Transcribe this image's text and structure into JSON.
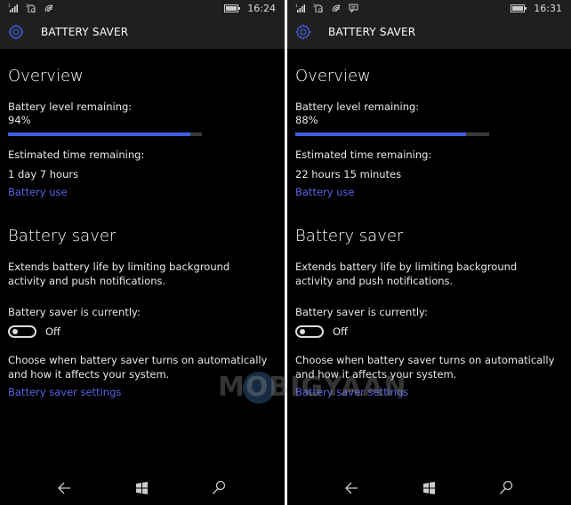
{
  "screens": [
    {
      "status": {
        "time": "16:24",
        "icons": [
          "signal-icon",
          "sim-icon",
          "wifi-icon"
        ]
      },
      "header": {
        "title": "BATTERY SAVER"
      },
      "overview": {
        "heading": "Overview",
        "battery_label": "Battery level remaining:",
        "battery_value": "94%",
        "battery_fraction": 0.94,
        "time_label": "Estimated time remaining:",
        "time_value": "1 day 7 hours",
        "battery_use_link": "Battery use"
      },
      "saver": {
        "heading": "Battery saver",
        "description": "Extends battery life by limiting background activity and push notifications.",
        "state_label": "Battery saver is currently:",
        "toggle_state": "Off",
        "choose_text": "Choose when battery saver turns on automatically and how it affects your system.",
        "settings_link": "Battery saver settings"
      }
    },
    {
      "status": {
        "time": "16:31",
        "icons": [
          "signal-icon",
          "sim-icon",
          "wifi-icon",
          "message-icon"
        ]
      },
      "header": {
        "title": "BATTERY SAVER"
      },
      "overview": {
        "heading": "Overview",
        "battery_label": "Battery level remaining:",
        "battery_value": "88%",
        "battery_fraction": 0.88,
        "time_label": "Estimated time remaining:",
        "time_value": "22 hours 15 minutes",
        "battery_use_link": "Battery use"
      },
      "saver": {
        "heading": "Battery saver",
        "description": "Extends battery life by limiting background activity and push notifications.",
        "state_label": "Battery saver is currently:",
        "toggle_state": "Off",
        "choose_text": "Choose when battery saver turns on automatically and how it affects your system.",
        "settings_link": "Battery saver settings"
      }
    }
  ],
  "navbar": {
    "back": "back-icon",
    "home": "windows-icon",
    "search": "search-icon"
  },
  "watermark": "MOBIGYAAN",
  "colors": {
    "accent": "#3f5fe0",
    "link": "#5563e6",
    "statusbar": "#1f1f1f"
  }
}
